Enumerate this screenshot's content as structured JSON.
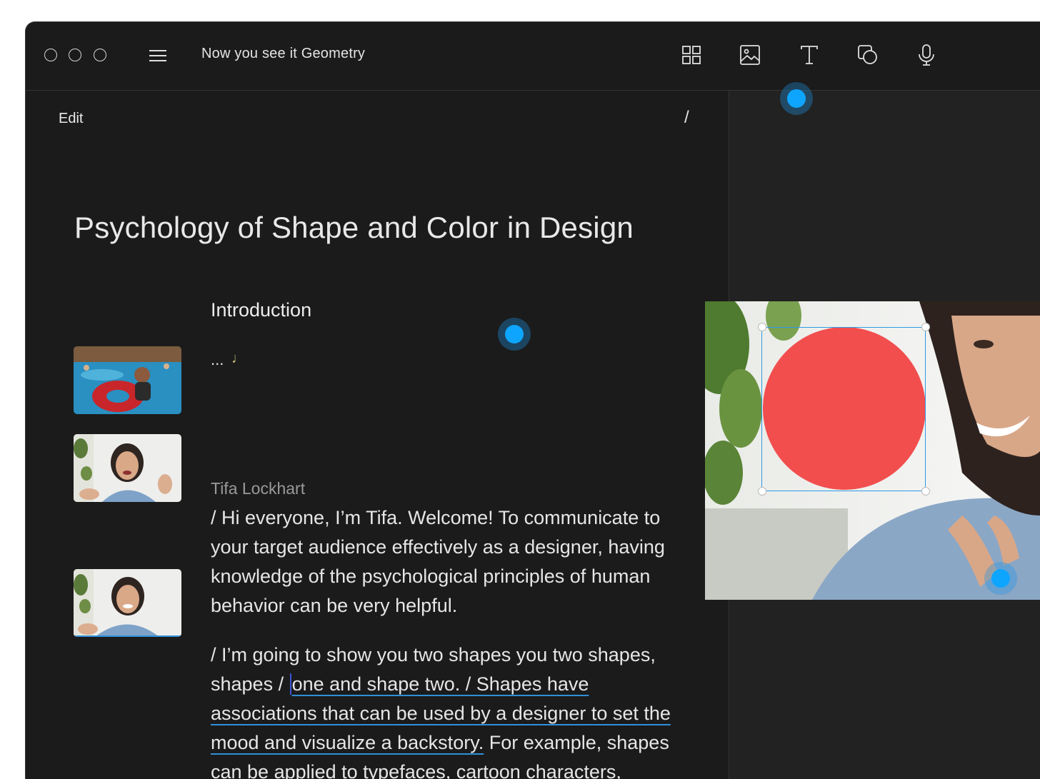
{
  "window": {
    "title": "Now you see it Geometry"
  },
  "toolbar": {
    "tools": [
      {
        "name": "grid-icon"
      },
      {
        "name": "image-icon"
      },
      {
        "name": "text-icon"
      },
      {
        "name": "shapes-icon"
      },
      {
        "name": "microphone-icon"
      }
    ]
  },
  "editor": {
    "edit_label": "Edit",
    "slash_label": "/",
    "title": "Psychology of Shape and Color in Design",
    "section_heading": "Introduction",
    "ellipsis": "...",
    "music_glyph": "♩",
    "speaker": "Tifa Lockhart",
    "paragraph1": "/ Hi everyone, I’m Tifa. Welcome! To communicate to your target audience effectively as a designer, having knowledge of the psychological principles of human behavior can be very helpful.",
    "paragraph2_before": "/ I’m going to show you two shapes you two shapes, shapes / ",
    "paragraph2_highlight": "one and shape two. / Shapes have associations that can be used by a designer to set the mood and visualize a backstory.",
    "paragraph2_after": " For example, shapes can be applied to typefaces, cartoon characters, compositions and logos."
  },
  "preview": {
    "shape_color": "#f24e4e",
    "selection_color": "#2e9ae6"
  },
  "colors": {
    "accent": "#0ea5ff",
    "background": "#1b1b1b",
    "panel": "#222222"
  }
}
